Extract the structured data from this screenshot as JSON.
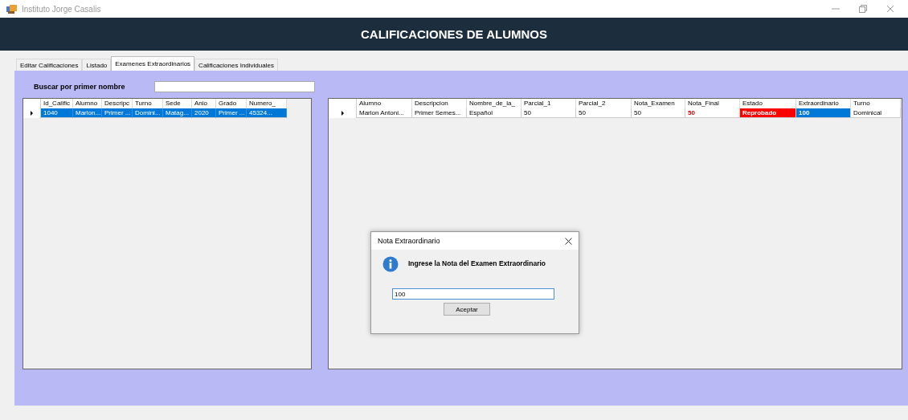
{
  "window": {
    "title": "Instituto Jorge Casalis"
  },
  "header": {
    "title": "CALIFICACIONES DE ALUMNOS"
  },
  "tabs": [
    {
      "label": "Editar Calificaciones",
      "selected": false
    },
    {
      "label": "Listado",
      "selected": false
    },
    {
      "label": "Examenes Extraordinarios",
      "selected": true
    },
    {
      "label": "Calificaciones Individuales",
      "selected": false
    }
  ],
  "search": {
    "label": "Buscar por primer nombre"
  },
  "left_table": {
    "columns": [
      "Id_Calific",
      "Alumno",
      "Descripc",
      "Turno",
      "Sede",
      "Anio",
      "Grado",
      "Numero_"
    ],
    "rows": [
      {
        "selected": true,
        "current": true,
        "cells": [
          {
            "text": "1040"
          },
          {
            "text": "Marlon..."
          },
          {
            "text": "Primer ..."
          },
          {
            "text": "Domini..."
          },
          {
            "text": "Matag..."
          },
          {
            "text": "2020"
          },
          {
            "text": "Primer ..."
          },
          {
            "text": "45324..."
          }
        ]
      }
    ]
  },
  "right_table": {
    "columns": [
      "Alumno",
      "Descripcion",
      "Nombre_de_la_",
      "Parcial_1",
      "Parcial_2",
      "Nota_Examen",
      "Nota_Final",
      "Estado",
      "Extraordinario",
      "Turno"
    ],
    "rows": [
      {
        "selected": false,
        "current": true,
        "cells": [
          {
            "text": "Marlon Antoni...",
            "kind": "plain"
          },
          {
            "text": "Primer Semes...",
            "kind": "plain"
          },
          {
            "text": "Español",
            "kind": "plain"
          },
          {
            "text": "50",
            "kind": "plain"
          },
          {
            "text": "50",
            "kind": "plain"
          },
          {
            "text": "50",
            "kind": "plain"
          },
          {
            "text": "50",
            "kind": "alert-text"
          },
          {
            "text": "Reprobado",
            "kind": "alert-fill"
          },
          {
            "text": "100",
            "kind": "highlight"
          },
          {
            "text": "Dominical",
            "kind": "plain"
          }
        ]
      }
    ]
  },
  "dialog": {
    "title": "Nota Extraordinario",
    "message": "Ingrese la Nota del Examen Extraordinario",
    "value": "100",
    "button": "Aceptar"
  }
}
